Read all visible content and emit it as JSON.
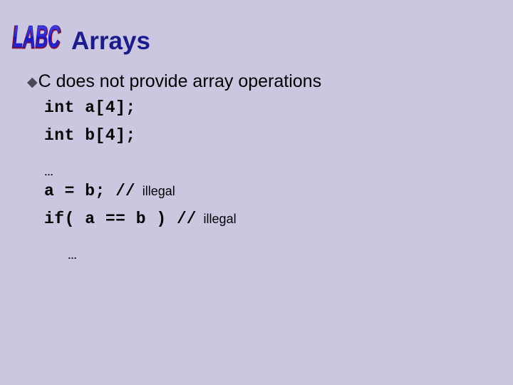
{
  "slide": {
    "background_color": "#ccc7e0",
    "header": {
      "logo_text": "LABC",
      "logo_fill_color": "#2b2bdd",
      "logo_shadow_color": "#8a1530",
      "title": "Arrays",
      "title_color": "#1b1b8f"
    },
    "body": {
      "bullet": {
        "marker": "◆",
        "marker_color": "#4a4a52",
        "text": "C does not provide array operations"
      },
      "code_lines": [
        {
          "kind": "code",
          "code": "int a[4];",
          "comment_marker": "",
          "comment_text": ""
        },
        {
          "kind": "code",
          "code": "int b[4];",
          "comment_marker": "",
          "comment_text": ""
        },
        {
          "kind": "ellipsis",
          "text": "…",
          "indented": false
        },
        {
          "kind": "code",
          "code": "a = b; ",
          "comment_marker": "//",
          "comment_text": "  illegal"
        },
        {
          "kind": "code",
          "code": "if( a == b ) ",
          "comment_marker": "//",
          "comment_text": "  illegal"
        },
        {
          "kind": "ellipsis",
          "text": "…",
          "indented": true
        }
      ]
    }
  }
}
